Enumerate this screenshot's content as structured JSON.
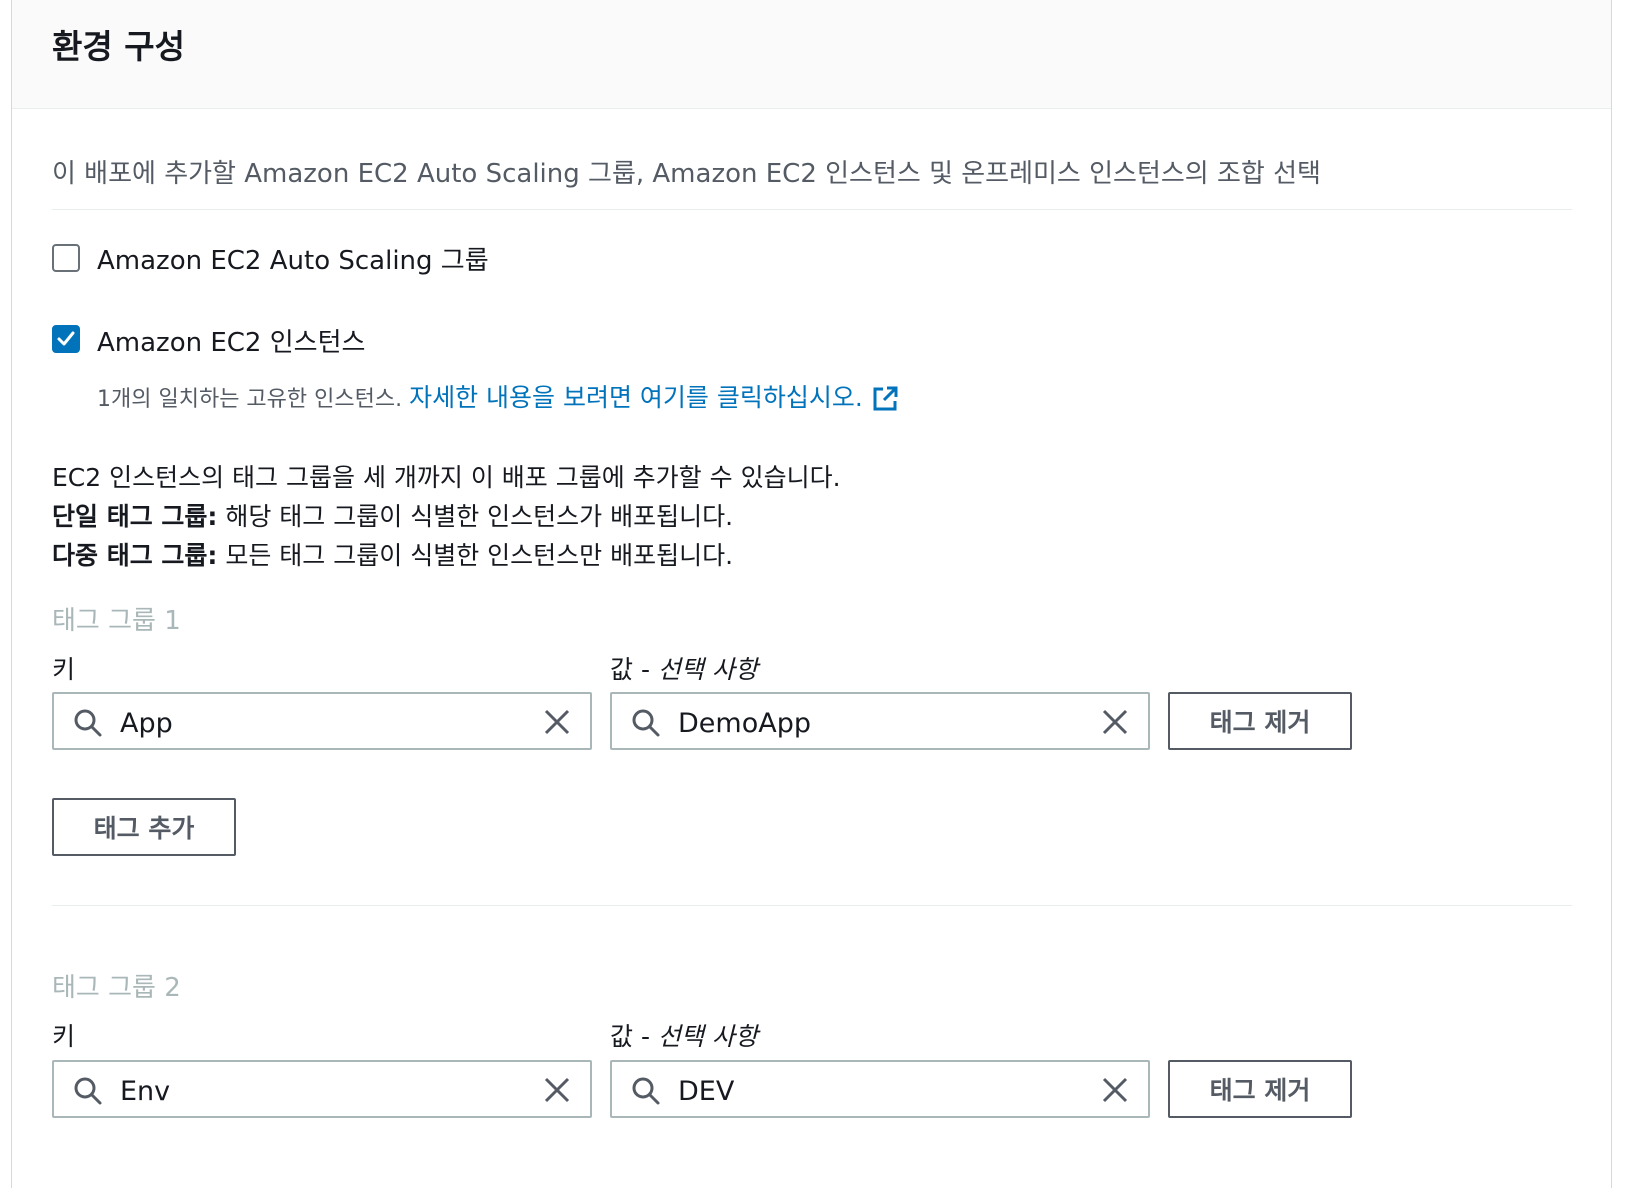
{
  "panel": {
    "title": "환경 구성",
    "intro": "이 배포에 추가할 Amazon EC2 Auto Scaling 그룹, Amazon EC2 인스턴스 및 온프레미스 인스턴스의 조합 선택"
  },
  "options": {
    "asg": {
      "label": "Amazon EC2 Auto Scaling 그룹",
      "checked": false
    },
    "ec2": {
      "label": "Amazon EC2 인스턴스",
      "checked": true,
      "match_text": "1개의 일치하는 고유한 인스턴스.",
      "link_text": "자세한 내용을 보려면 여기를 클릭하십시오.",
      "link_icon": "external-link-icon"
    }
  },
  "info": {
    "line1": "EC2 인스턴스의 태그 그룹을 세 개까지 이 배포 그룹에 추가할 수 있습니다.",
    "single_bold": "단일 태그 그룹:",
    "single_text": " 해당 태그 그룹이 식별한 인스턴스가 배포됩니다.",
    "multi_bold": "다중 태그 그룹:",
    "multi_text": " 모든 태그 그룹이 식별한 인스턴스만 배포됩니다."
  },
  "tag_groups": [
    {
      "title": "태그 그룹 1",
      "key_label": "키",
      "value_label_main": "값 - ",
      "value_label_optional": "선택 사항",
      "key_value": "App",
      "value_value": "DemoApp",
      "remove_label": "태그 제거",
      "add_label": "태그 추가"
    },
    {
      "title": "태그 그룹 2",
      "key_label": "키",
      "value_label_main": "값 - ",
      "value_label_optional": "선택 사항",
      "key_value": "Env",
      "value_value": "DEV",
      "remove_label": "태그 제거"
    }
  ],
  "colors": {
    "accent": "#0073bb",
    "muted_text": "#545b64",
    "group_title": "#aab7b8"
  },
  "icons": {
    "search": "search-icon",
    "clear": "close-icon",
    "check": "checkmark-icon"
  }
}
